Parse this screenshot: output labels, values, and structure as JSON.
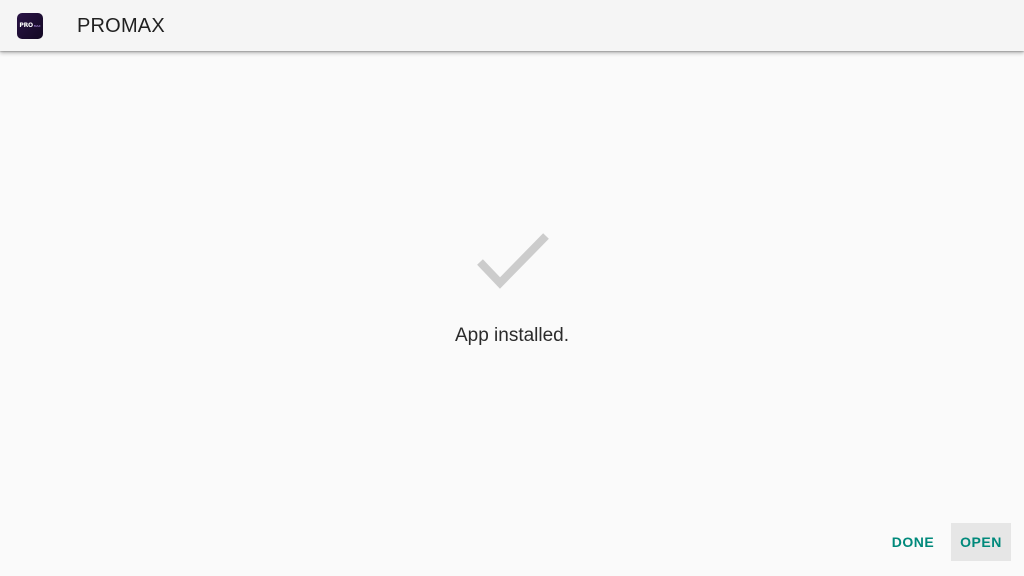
{
  "app_bar": {
    "icon_text": "PRO",
    "icon_subtext": "MAX",
    "title": "PROMAX"
  },
  "status": {
    "icon": "checkmark-icon",
    "message": "App installed."
  },
  "actions": {
    "done_label": "DONE",
    "open_label": "OPEN"
  },
  "colors": {
    "background": "#fafafa",
    "app_bar": "#f5f5f5",
    "accent": "#00897b",
    "check": "#cccccc",
    "focused_button_bg": "#e6e6e6"
  }
}
